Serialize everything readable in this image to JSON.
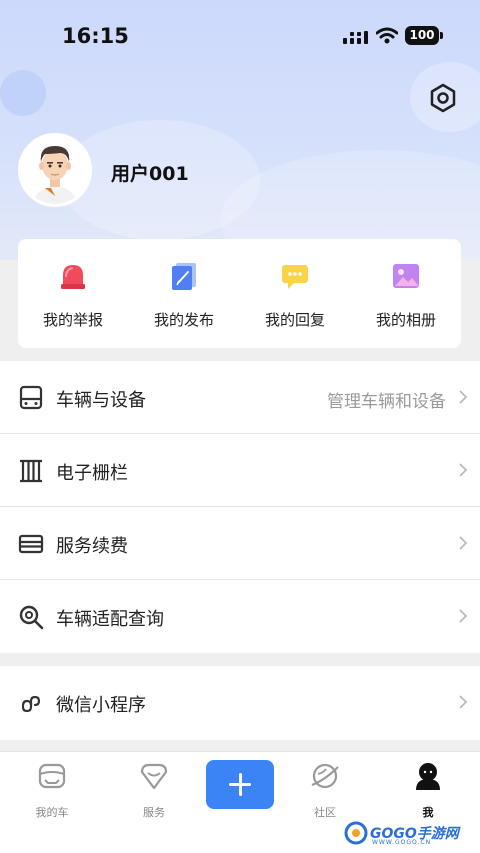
{
  "status": {
    "time": "16:15",
    "battery": "100"
  },
  "profile": {
    "username": "用户001"
  },
  "quick_actions": [
    {
      "label": "我的举报",
      "icon": "alarm-light-icon"
    },
    {
      "label": "我的发布",
      "icon": "document-edit-icon"
    },
    {
      "label": "我的回复",
      "icon": "chat-bubble-icon"
    },
    {
      "label": "我的相册",
      "icon": "photo-album-icon"
    }
  ],
  "menu_group1": [
    {
      "title": "车辆与设备",
      "hint": "管理车辆和设备",
      "icon": "vehicle-icon"
    },
    {
      "title": "电子栅栏",
      "hint": "",
      "icon": "fence-icon"
    },
    {
      "title": "服务续费",
      "hint": "",
      "icon": "card-icon"
    },
    {
      "title": "车辆适配查询",
      "hint": "",
      "icon": "search-icon"
    }
  ],
  "menu_group2": [
    {
      "title": "微信小程序",
      "hint": "",
      "icon": "mini-program-icon"
    }
  ],
  "tabbar": {
    "tabs": [
      {
        "label": "我的车",
        "icon": "car-face-icon"
      },
      {
        "label": "服务",
        "icon": "service-icon"
      },
      {
        "label": "社区",
        "icon": "planet-icon"
      },
      {
        "label": "我",
        "icon": "user-icon"
      }
    ],
    "active": "我"
  },
  "watermark": {
    "text": "GOGO手游网",
    "sub": "WWW.GOGO.CN"
  },
  "colors": {
    "accent": "#3b84f6",
    "header_bg": "#cdd9fb"
  }
}
